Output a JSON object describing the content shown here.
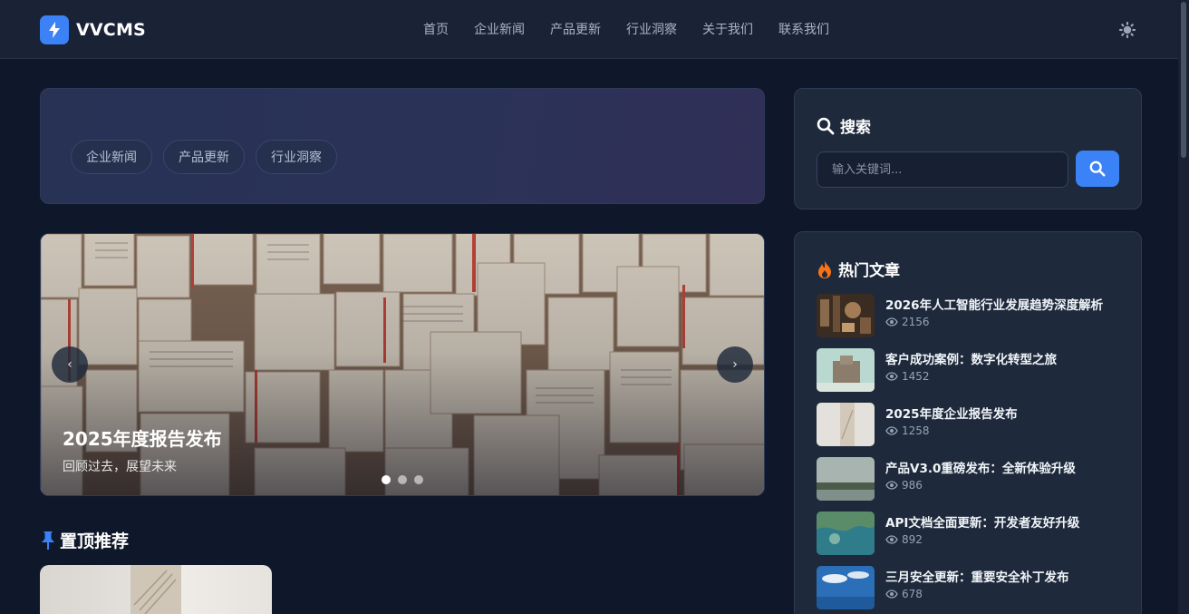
{
  "header": {
    "logo_text": "VVCMS",
    "nav": [
      "首页",
      "企业新闻",
      "产品更新",
      "行业洞察",
      "关于我们",
      "联系我们"
    ]
  },
  "categories": [
    "企业新闻",
    "产品更新",
    "行业洞察"
  ],
  "carousel": {
    "title": "2025年度报告发布",
    "subtitle": "回顾过去，展望未来",
    "prev": "‹",
    "next": "›",
    "slide_count": 3,
    "active_index": 0
  },
  "pinned": {
    "title": "置顶推荐"
  },
  "search": {
    "title": "搜索",
    "placeholder": "输入关键词..."
  },
  "hot": {
    "title": "热门文章",
    "items": [
      {
        "title": "2026年人工智能行业发展趋势深度解析",
        "views": "2156"
      },
      {
        "title": "客户成功案例：数字化转型之旅",
        "views": "1452"
      },
      {
        "title": "2025年度企业报告发布",
        "views": "1258"
      },
      {
        "title": "产品V3.0重磅发布：全新体验升级",
        "views": "986"
      },
      {
        "title": "API文档全面更新：开发者友好升级",
        "views": "892"
      },
      {
        "title": "三月安全更新：重要安全补丁发布",
        "views": "678"
      }
    ]
  },
  "colors": {
    "background": "#0f172a",
    "panel": "#1e293b",
    "accent": "#3b82f6",
    "fire": "#f97316"
  },
  "icons": [
    "bolt-icon",
    "sun-icon",
    "search-icon",
    "fire-icon",
    "pin-icon",
    "eye-icon"
  ]
}
